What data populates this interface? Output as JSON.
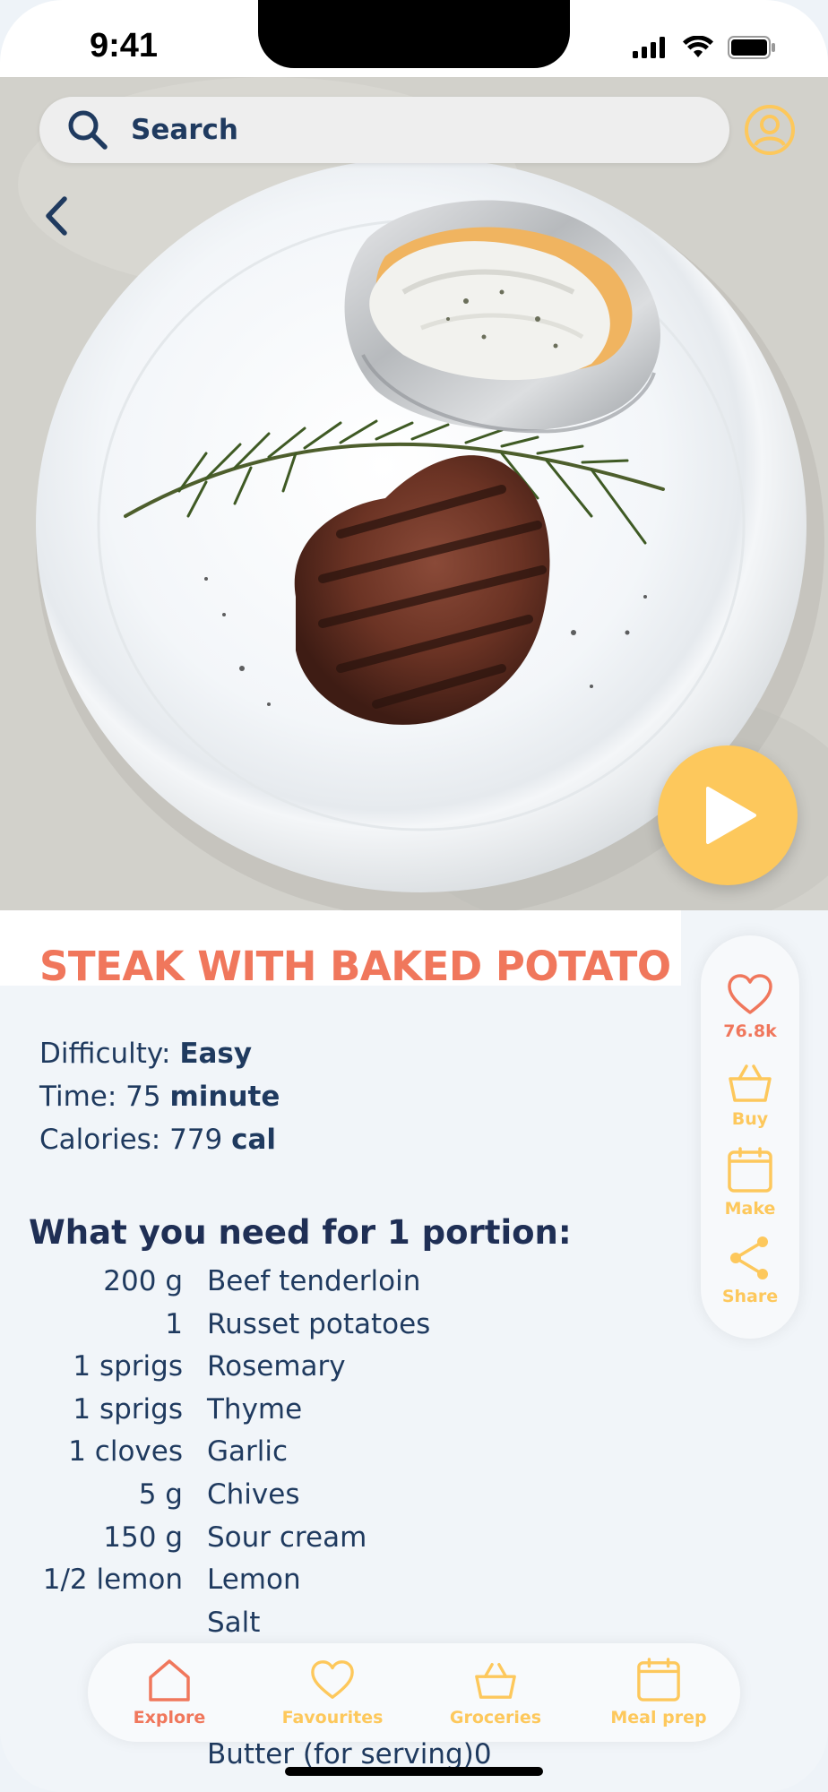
{
  "status_bar": {
    "time": "9:41"
  },
  "search": {
    "placeholder": "Search"
  },
  "recipe": {
    "title": "STEAK WITH BAKED POTATO",
    "difficulty_label": "Difficulty: ",
    "difficulty_value": "Easy",
    "time_label": "Time: 75 ",
    "time_unit": "minute",
    "calories_label": "Calories: 779 ",
    "calories_unit": "cal",
    "portion_heading": "What you need for 1 portion:",
    "ingredients": [
      {
        "qty": "200 g",
        "name": "Beef tenderloin"
      },
      {
        "qty": "1",
        "name": "Russet potatoes"
      },
      {
        "qty": "1 sprigs",
        "name": "Rosemary"
      },
      {
        "qty": "1 sprigs",
        "name": "Thyme"
      },
      {
        "qty": "1 cloves",
        "name": "Garlic"
      },
      {
        "qty": "5 g",
        "name": "Chives"
      },
      {
        "qty": "150 g",
        "name": "Sour cream"
      },
      {
        "qty": "1/2 lemon",
        "name": "Lemon"
      },
      {
        "qty": "",
        "name": "Salt"
      }
    ],
    "last_ingredient_partial": "Butter (for serving)0"
  },
  "actions": {
    "likes_count": "76.8k",
    "buy_label": "Buy",
    "make_label": "Make",
    "share_label": "Share"
  },
  "nav": {
    "explore": "Explore",
    "favourites": "Favourites",
    "groceries": "Groceries",
    "meal_prep": "Meal prep",
    "active": "Explore"
  },
  "colors": {
    "accent_coral": "#f0775c",
    "accent_yellow": "#fdc85c",
    "navy": "#1f3a5f"
  },
  "icons": {
    "search": "search-icon",
    "profile": "profile-icon",
    "back": "back-chevron-icon",
    "play": "play-icon",
    "like": "heart-icon",
    "buy": "basket-icon",
    "make": "calendar-icon",
    "share": "share-icon"
  }
}
